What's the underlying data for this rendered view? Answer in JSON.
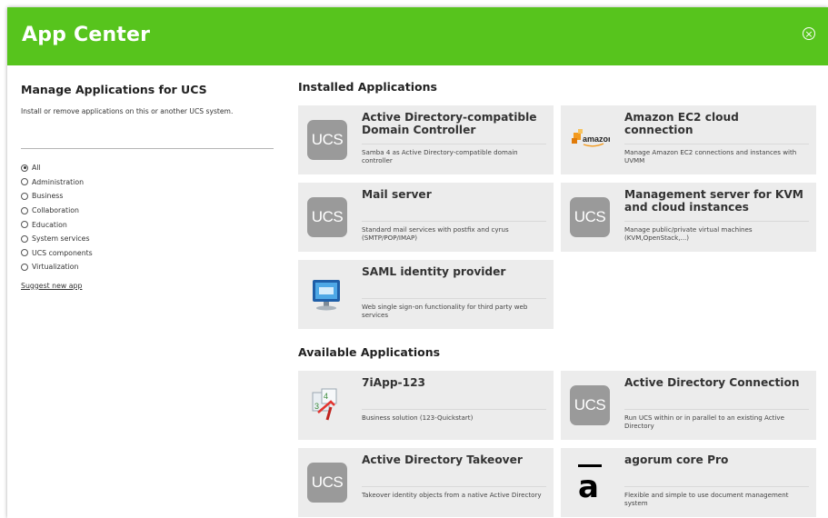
{
  "window": {
    "title": "App Center",
    "close_symbol": "⊗",
    "accent_color": "#57c41d"
  },
  "sidebar": {
    "title": "Manage Applications for UCS",
    "description": "Install or remove applications on this or another UCS system.",
    "search_value": "",
    "categories": [
      {
        "label": "All",
        "checked": true
      },
      {
        "label": "Administration",
        "checked": false
      },
      {
        "label": "Business",
        "checked": false
      },
      {
        "label": "Collaboration",
        "checked": false
      },
      {
        "label": "Education",
        "checked": false
      },
      {
        "label": "System services",
        "checked": false
      },
      {
        "label": "UCS components",
        "checked": false
      },
      {
        "label": "Virtualization",
        "checked": false
      }
    ],
    "suggest_link": "Suggest new app"
  },
  "installed": {
    "title": "Installed Applications",
    "apps": [
      {
        "name": "Active Directory-compatible Domain Controller",
        "description": "Samba 4 as Active Directory-compatible domain controller",
        "icon": "ucs-icon",
        "icon_text": "UCS"
      },
      {
        "name": "Amazon EC2 cloud connection",
        "description": "Manage Amazon EC2 connections and instances with UVMM",
        "icon": "amazon-icon",
        "icon_text": "amazon"
      },
      {
        "name": "Mail server",
        "description": "Standard mail services with postfix and cyrus (SMTP/POP/IMAP)",
        "icon": "ucs-icon",
        "icon_text": "UCS"
      },
      {
        "name": "Management server for KVM and cloud instances",
        "description": "Manage public/private virtual machines (KVM,OpenStack,...)",
        "icon": "ucs-icon",
        "icon_text": "UCS"
      },
      {
        "name": "SAML identity provider",
        "description": "Web single sign-on functionality for third party web services",
        "icon": "monitor-icon",
        "icon_text": ""
      }
    ]
  },
  "available": {
    "title": "Available Applications",
    "apps": [
      {
        "name": "7iApp-123",
        "description": "Business solution (123-Quickstart)",
        "icon": "calendar-icon",
        "icon_text": ""
      },
      {
        "name": "Active Directory Connection",
        "description": "Run UCS within or in parallel to an existing Active Directory",
        "icon": "ucs-icon",
        "icon_text": "UCS"
      },
      {
        "name": "Active Directory Takeover",
        "description": "Takeover identity objects from a native Active Directory",
        "icon": "ucs-icon",
        "icon_text": "UCS"
      },
      {
        "name": "agorum core Pro",
        "description": "Flexible and simple to use document management system",
        "icon": "agorum-icon",
        "icon_text": "a"
      }
    ]
  }
}
